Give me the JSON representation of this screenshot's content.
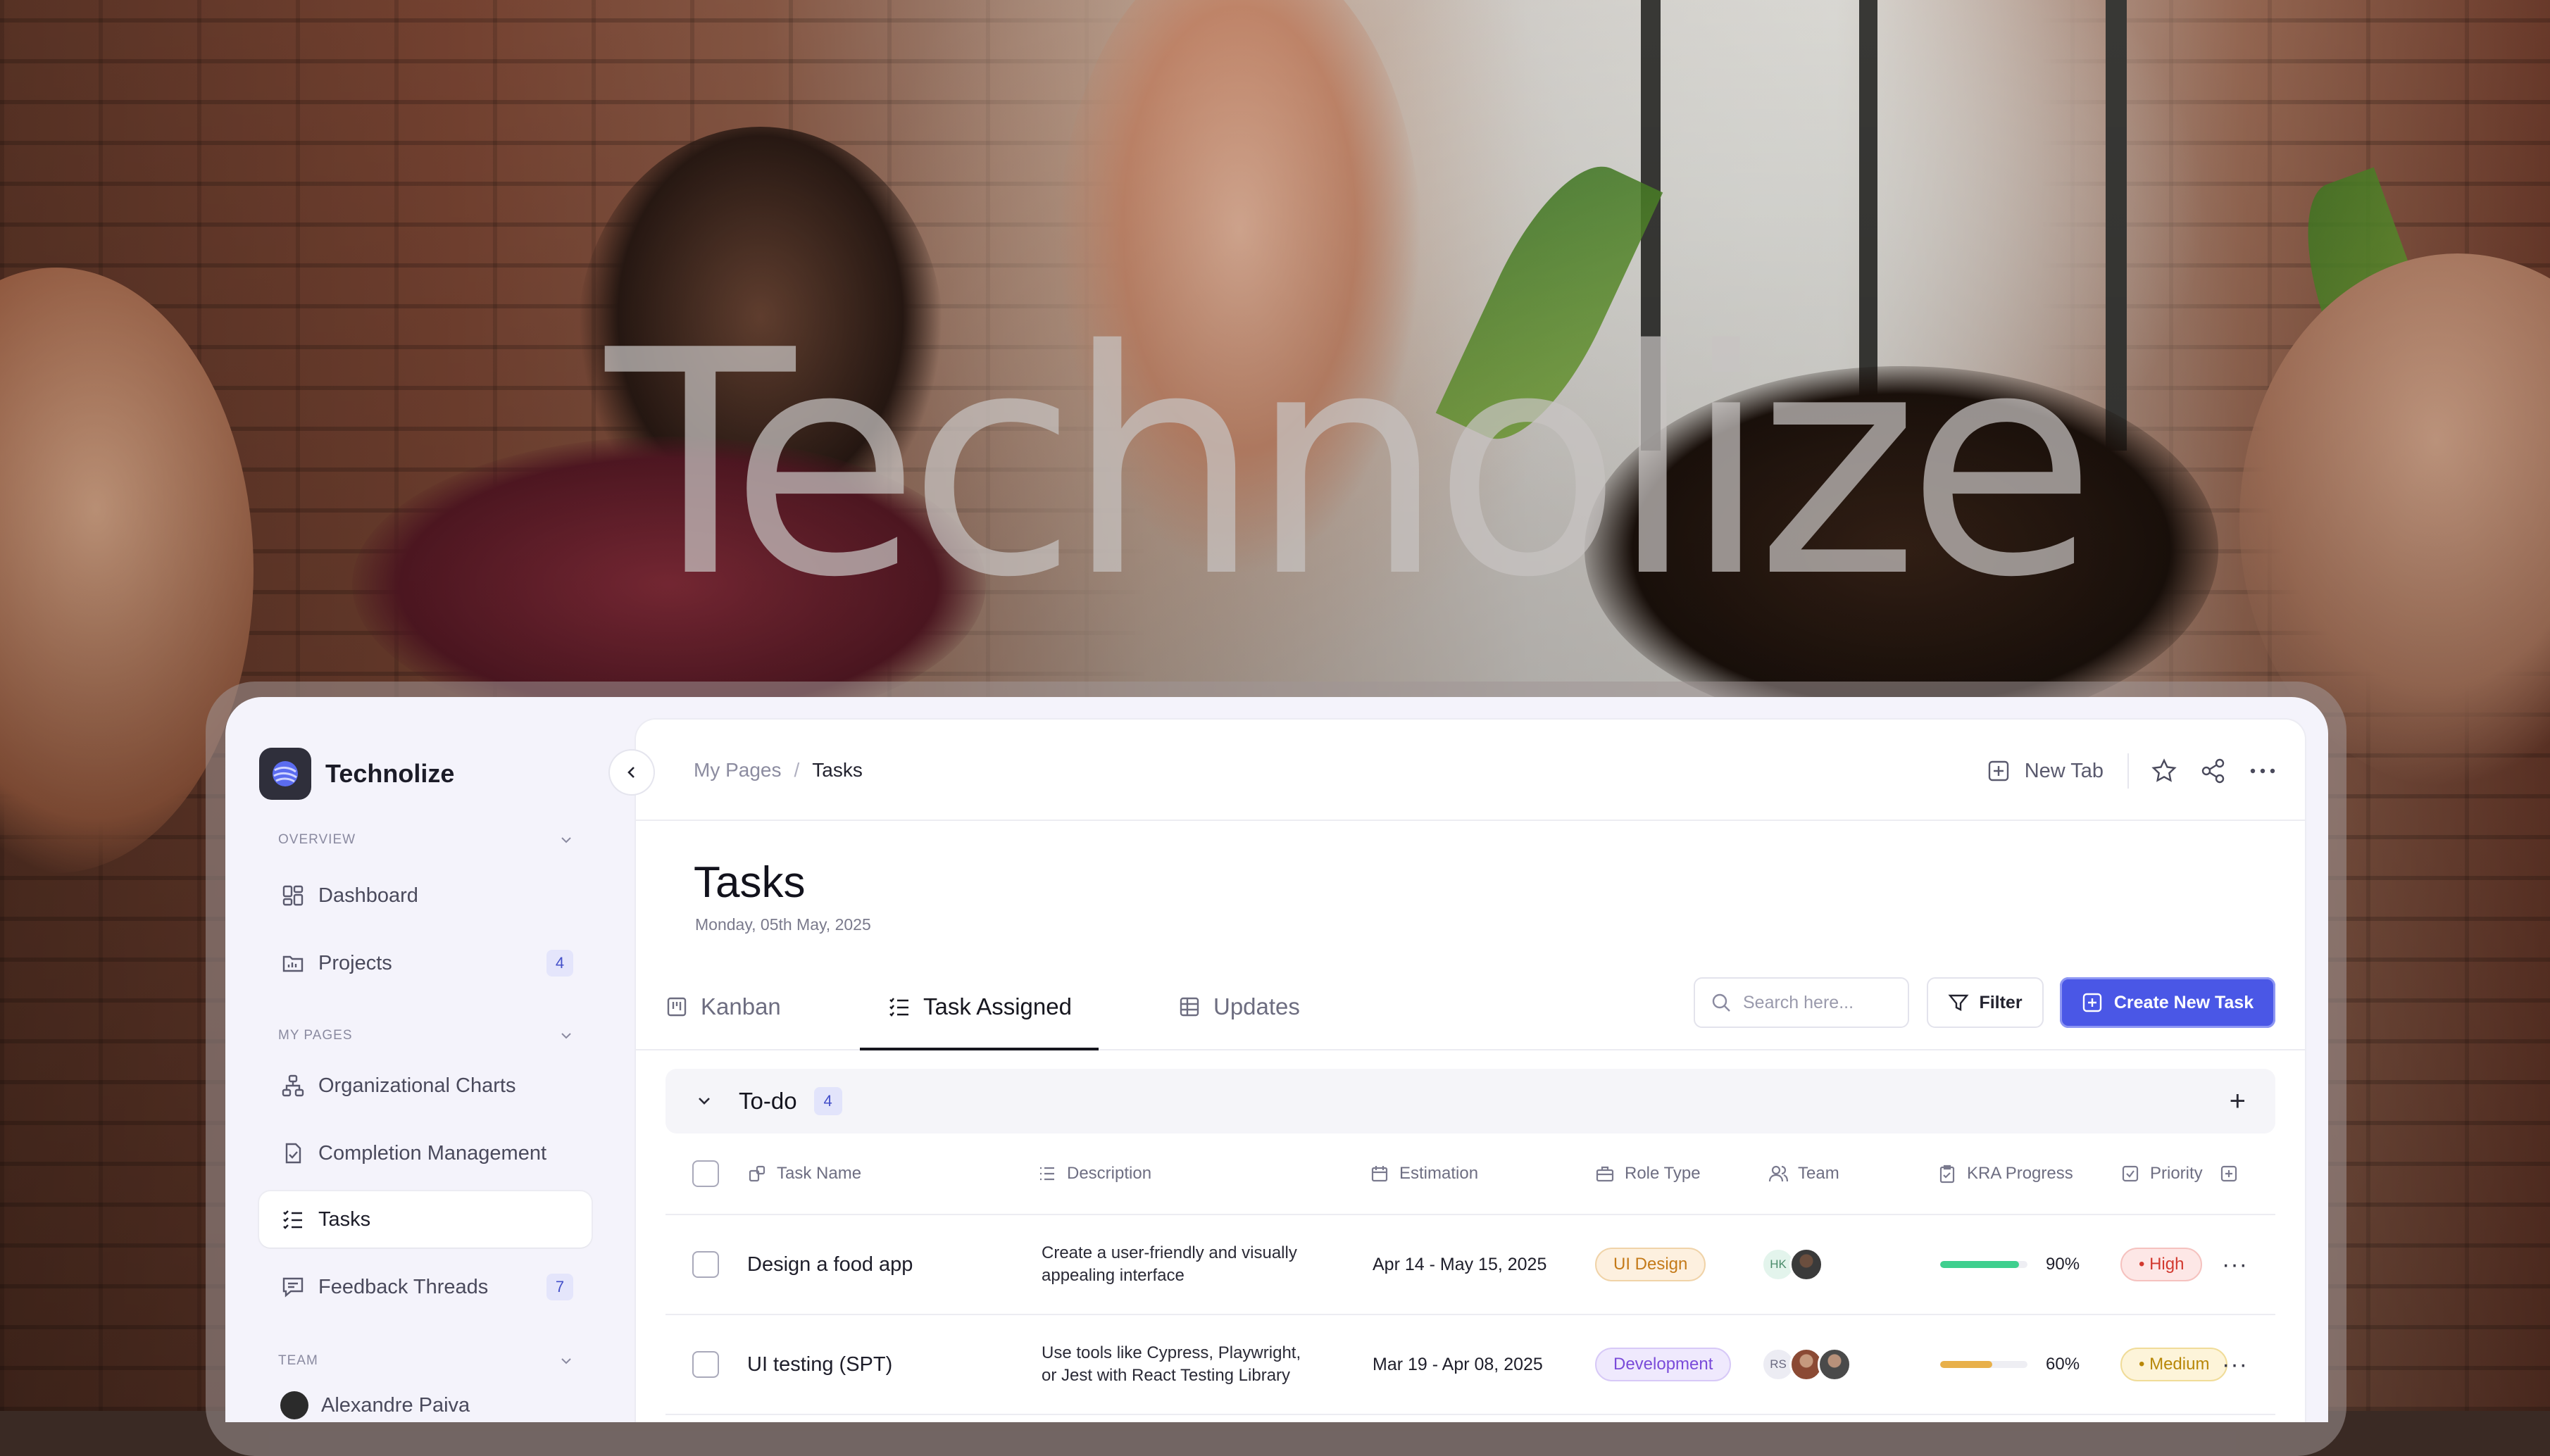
{
  "watermark": "Technolize",
  "brand": {
    "name": "Technolize"
  },
  "sidebar": {
    "overview_label": "OVERVIEW",
    "overview_items": [
      {
        "label": "Dashboard"
      },
      {
        "label": "Projects",
        "count": "4"
      }
    ],
    "mypages_label": "MY PAGES",
    "mypages_items": [
      {
        "label": "Organizational Charts"
      },
      {
        "label": "Completion Management"
      },
      {
        "label": "Tasks",
        "active": true
      },
      {
        "label": "Feedback Threads",
        "count": "7"
      }
    ],
    "team_label": "TEAM",
    "team_items": [
      {
        "label": "Alexandre Paiva"
      }
    ]
  },
  "breadcrumb": {
    "parent": "My Pages",
    "separator": "/",
    "current": "Tasks"
  },
  "topbar": {
    "new_tab": "New Tab"
  },
  "page": {
    "title": "Tasks",
    "date": "Monday, 05th May, 2025"
  },
  "tabs": [
    {
      "label": "Kanban"
    },
    {
      "label": "Task Assigned",
      "active": true
    },
    {
      "label": "Updates"
    }
  ],
  "search": {
    "placeholder": "Search here..."
  },
  "filter_label": "Filter",
  "create_label": "Create New Task",
  "group": {
    "title": "To-do",
    "count": "4"
  },
  "columns": [
    "Task Name",
    "Description",
    "Estimation",
    "Role Type",
    "Team",
    "KRA Progress",
    "Priority"
  ],
  "rows": [
    {
      "name": "Design a food app",
      "desc_line1": "Create a user-friendly and visually",
      "desc_line2": "appealing interface",
      "estimation": "Apr 14 - May 15, 2025",
      "role": "UI Design",
      "team_initials": "HK",
      "progress": 0.9,
      "progress_label": "90%",
      "priority": "High"
    },
    {
      "name": "UI testing (SPT)",
      "desc_line1": "Use tools like Cypress, Playwright,",
      "desc_line2": "or Jest with React Testing Library",
      "estimation": "Mar 19 - Apr 08, 2025",
      "role": "Development",
      "team_initials": "RS",
      "progress": 0.6,
      "progress_label": "60%",
      "priority": "Medium"
    }
  ],
  "colors": {
    "accent": "#4a57e6",
    "progress_high": "#3ecf8e",
    "progress_mid": "#e8b04a"
  }
}
